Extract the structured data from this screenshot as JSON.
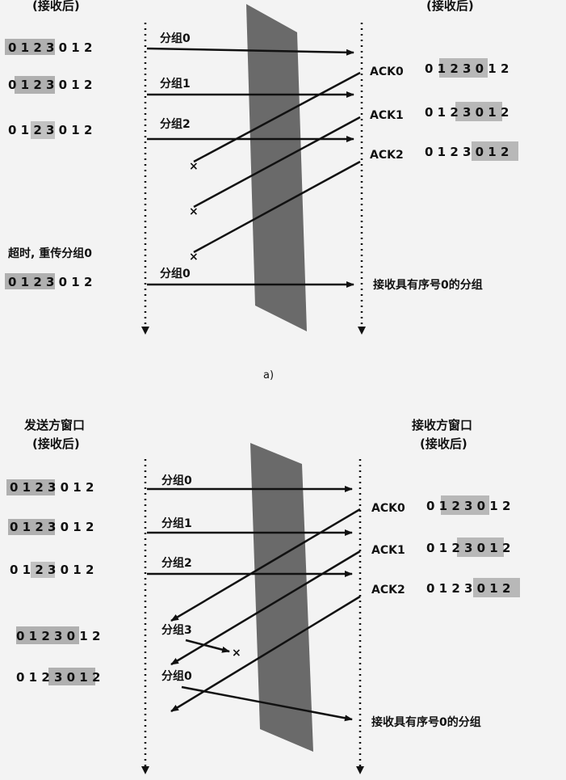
{
  "part_a": {
    "sender_header": "(接收后)",
    "receiver_header": "(接收后)",
    "caption": "a)",
    "sender_windows": [
      "0 1 2 3 0 1 2",
      "0 1 2 3 0 1 2",
      "0 1 2 3 0 1 2",
      "0 1 2 3 0 1 2"
    ],
    "timeout_text": "超时, 重传分组0",
    "packets": [
      "分组0",
      "分组1",
      "分组2",
      "分组0"
    ],
    "acks": [
      "ACK0",
      "ACK1",
      "ACK2"
    ],
    "receiver_windows": [
      "0 1 2 3 0 1 2",
      "0 1 2 3 0 1 2",
      "0 1 2 3 0 1 2"
    ],
    "receive_note": "接收具有序号0的分组",
    "loss_mark": "×"
  },
  "part_b": {
    "sender_title": "发送方窗口",
    "sender_header": "(接收后)",
    "receiver_title": "接收方窗口",
    "receiver_header": "(接收后)",
    "sender_windows": [
      "0 1 2 3 0 1 2",
      "0 1 2 3 0 1 2",
      "0 1 2 3 0 1 2",
      "0 1 2 3 0 1 2",
      "0 1 2 3 0 1 2"
    ],
    "packets": [
      "分组0",
      "分组1",
      "分组2",
      "分组3",
      "分组0"
    ],
    "acks": [
      "ACK0",
      "ACK1",
      "ACK2"
    ],
    "receiver_windows": [
      "0 1 2 3 0 1 2",
      "0 1 2 3 0 1 2",
      "0 1 2 3 0 1 2"
    ],
    "receive_note": "接收具有序号0的分组",
    "loss_mark": "×"
  }
}
